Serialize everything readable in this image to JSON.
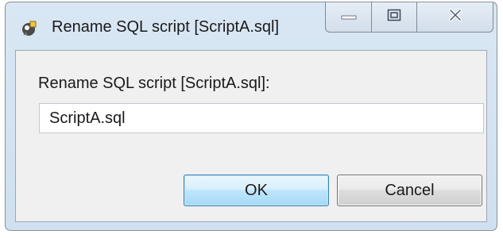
{
  "window": {
    "title": "Rename SQL script [ScriptA.sql]",
    "icon": "eclipse-dialog-icon",
    "controls": [
      "minimize-icon",
      "maximize-icon",
      "close-icon"
    ]
  },
  "dialog": {
    "prompt": "Rename SQL script [ScriptA.sql]:",
    "name_value": "ScriptA.sql",
    "ok_label": "OK",
    "cancel_label": "Cancel"
  },
  "colors": {
    "frame": "#d3e3f3",
    "client": "#f0f0f0",
    "default_button_border": "#3c7fb1"
  }
}
